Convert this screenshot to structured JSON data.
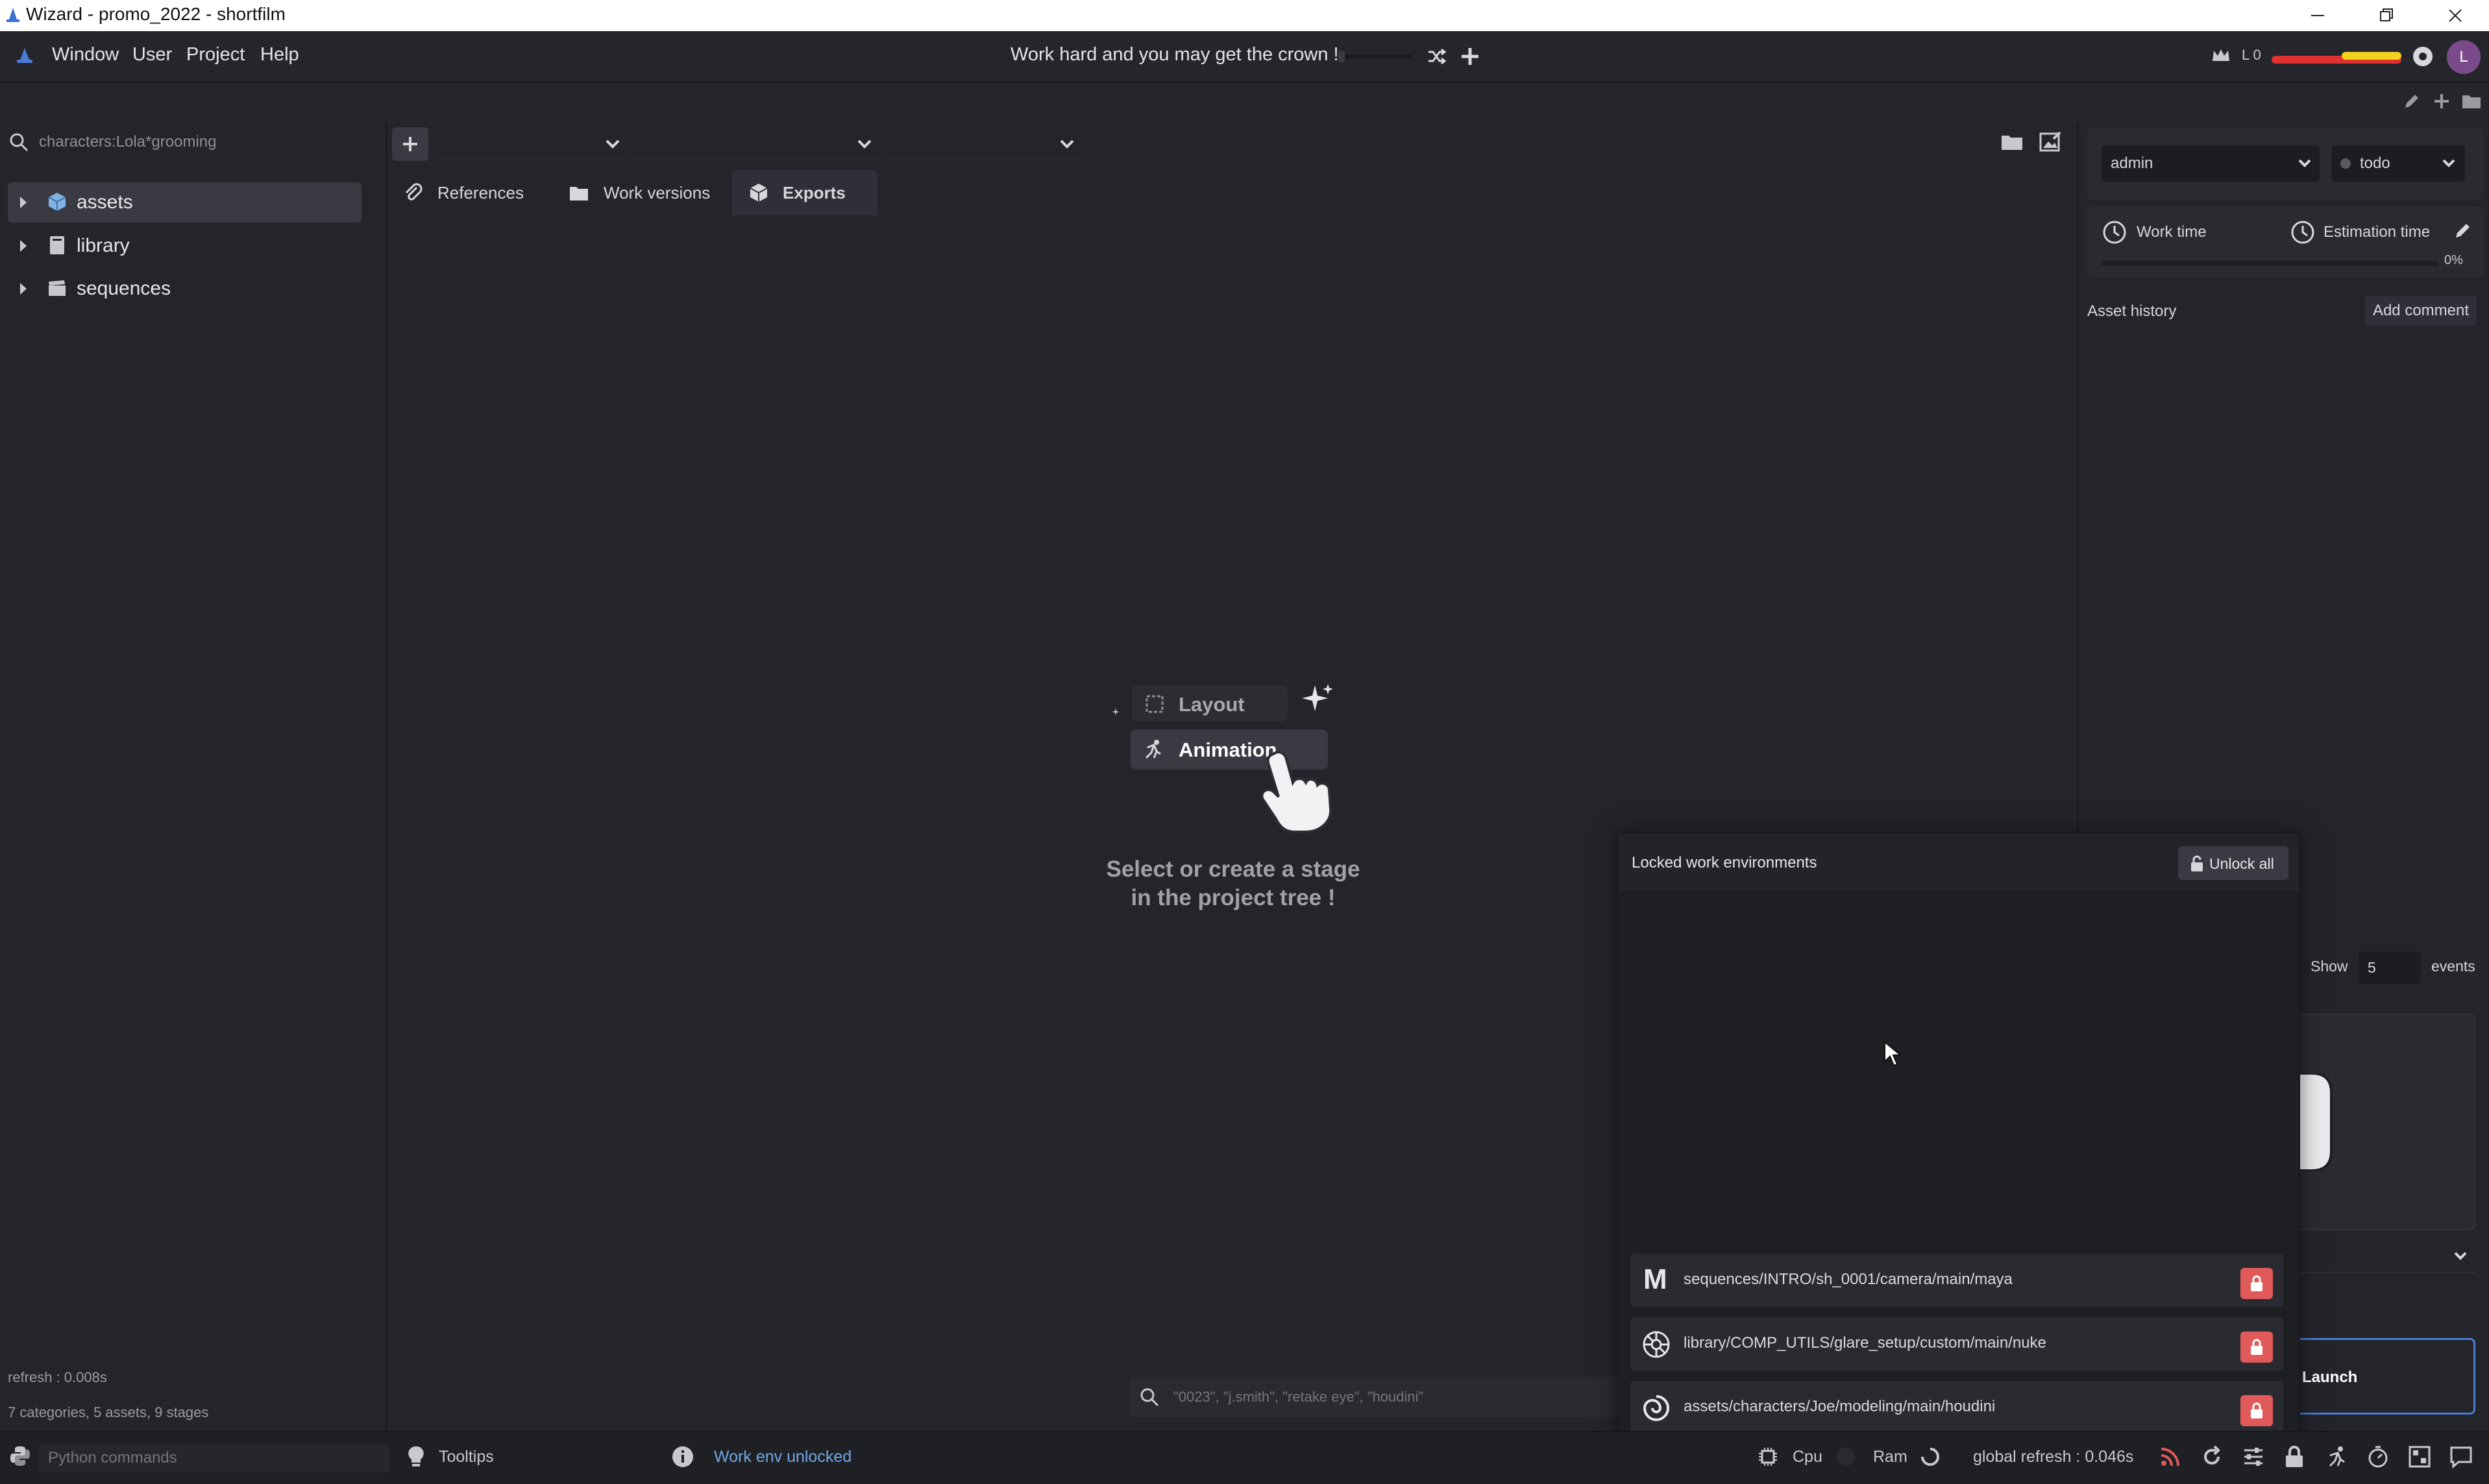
{
  "window": {
    "title": "Wizard - promo_2022 - shortfilm"
  },
  "menu": {
    "items": [
      "Window",
      "User",
      "Project",
      "Help"
    ],
    "motto": "Work hard and you may get the crown !",
    "level_label": "L 0",
    "avatar_letter": "L"
  },
  "search": {
    "value": "characters:Lola*grooming"
  },
  "tree": {
    "items": [
      {
        "label": "assets",
        "icon": "cube-icon"
      },
      {
        "label": "library",
        "icon": "book-icon"
      },
      {
        "label": "sequences",
        "icon": "clapper-icon"
      }
    ]
  },
  "left_status": {
    "refresh": "refresh : 0.008s",
    "summary": "7 categories, 5 assets, 9 stages"
  },
  "tabs": {
    "references": "References",
    "work_versions": "Work versions",
    "exports": "Exports"
  },
  "empty_state": {
    "layout_label": "Layout",
    "animation_label": "Animation",
    "message_line1": "Select or create a stage",
    "message_line2": "in the project tree !"
  },
  "bottom_search": {
    "placeholder": "\"0023\", \"j.smith\", \"retake eye\", \"houdini\""
  },
  "right": {
    "user": "admin",
    "state": "todo",
    "work_time_label": "Work time",
    "estimation_label": "Estimation time",
    "progress_text": "0%",
    "progress": 0,
    "history_label": "Asset history",
    "add_comment": "Add comment",
    "show_label": "Show",
    "show_value": "5",
    "events_label": "events",
    "launch_label": "Launch"
  },
  "popup": {
    "title": "Locked work environments",
    "unlock_all": "Unlock all",
    "rows": [
      {
        "path": "sequences/INTRO/sh_0001/camera/main/maya",
        "icon": "maya-icon"
      },
      {
        "path": "library/COMP_UTILS/glare_setup/custom/main/nuke",
        "icon": "nuke-icon"
      },
      {
        "path": "assets/characters/Joe/modeling/main/houdini",
        "icon": "houdini-icon"
      }
    ]
  },
  "statusbar": {
    "python_placeholder": "Python commands",
    "tooltips": "Tooltips",
    "work_env": "Work env unlocked",
    "cpu": "Cpu",
    "ram": "Ram",
    "global_refresh": "global refresh : 0.046s"
  },
  "colors": {
    "accent_blue": "#4a7bd6",
    "lock_red": "#e05a5a",
    "xp_red": "#e03030",
    "xp_yellow": "#f2d21c",
    "work_env_text": "#6fa8e8"
  }
}
